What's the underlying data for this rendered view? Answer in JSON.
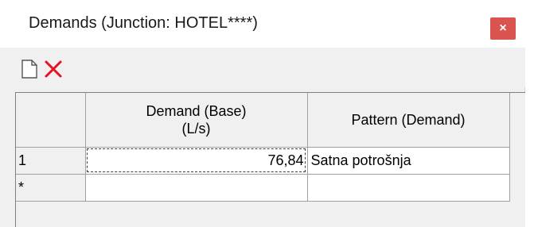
{
  "window": {
    "title": "Demands (Junction:  HOTEL****)",
    "close_label": "×"
  },
  "toolbar": {
    "new_icon": "new-document-icon",
    "delete_icon": "delete-x-icon"
  },
  "colors": {
    "close_button": "#d9534f",
    "delete_x": "#e81123"
  },
  "grid": {
    "columns": [
      {
        "line1": "Demand (Base)",
        "line2": "(L/s)"
      },
      {
        "line1": "Pattern (Demand)",
        "line2": ""
      }
    ],
    "rows": [
      {
        "header": "1",
        "demand": "76,84",
        "pattern": "Satna potrošnja"
      },
      {
        "header": "*",
        "demand": "",
        "pattern": ""
      }
    ]
  }
}
